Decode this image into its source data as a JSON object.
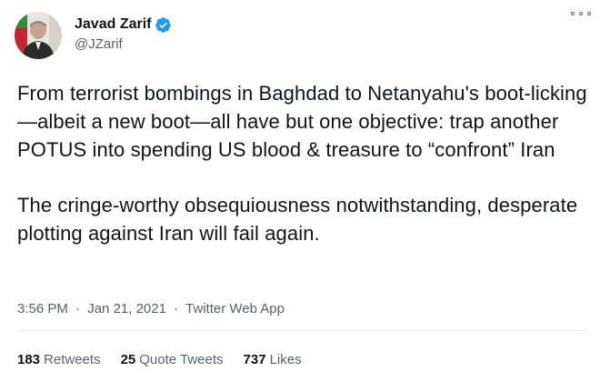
{
  "author": {
    "display_name": "Javad Zarif",
    "handle": "@JZarif",
    "verified": true,
    "verified_color": "#1d9bf0",
    "avatar_icon": "user-avatar-photo",
    "more_icon": "more-options-icon"
  },
  "tweet": {
    "paragraphs": [
      "From terrorist bombings in Baghdad to Netanyahu's boot-licking—albeit a new boot—all have but one objective: trap another POTUS into spending US blood & treasure to “confront” Iran",
      "The cringe-worthy obsequiousness notwithstanding, desperate plotting against Iran will fail again."
    ]
  },
  "meta": {
    "time": "3:56 PM",
    "separator": "·",
    "date": "Jan 21, 2021",
    "source": "Twitter Web App"
  },
  "stats": {
    "retweets": {
      "count": "183",
      "label": "Retweets"
    },
    "quote_tweets": {
      "count": "25",
      "label": "Quote Tweets"
    },
    "likes": {
      "count": "737",
      "label": "Likes"
    }
  }
}
